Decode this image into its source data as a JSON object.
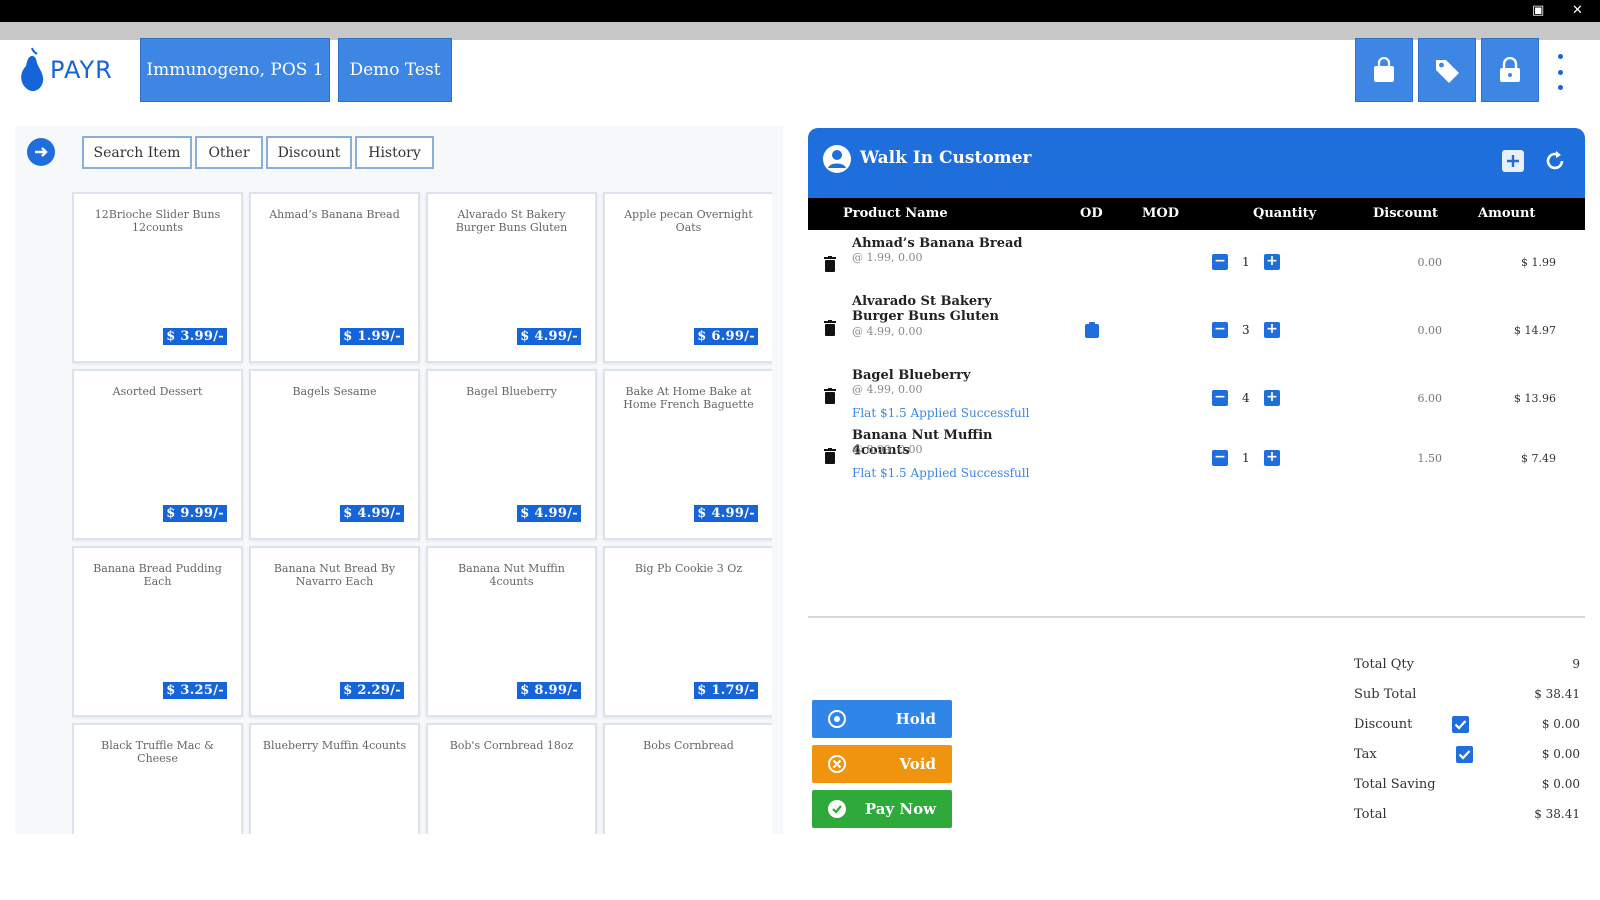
{
  "window": {
    "restore_glyph": "▣",
    "close_glyph": "✕"
  },
  "header": {
    "logo_text": "PAYR",
    "store_button": "Immunogeno, POS 1",
    "user_button": "Demo Test",
    "icons": [
      "bag-icon",
      "tag-icon",
      "lock-icon",
      "kebab-menu-icon"
    ]
  },
  "tabs": [
    "Search Item",
    "Other",
    "Discount",
    "History"
  ],
  "products": [
    {
      "name": "12Brioche Slider Buns 12counts",
      "price": "$ 3.99/-"
    },
    {
      "name": "Ahmad’s Banana Bread",
      "price": "$ 1.99/-"
    },
    {
      "name": "Alvarado St Bakery Burger Buns Gluten",
      "price": "$ 4.99/-"
    },
    {
      "name": "Apple pecan Overnight Oats",
      "price": "$ 6.99/-"
    },
    {
      "name": "Asorted Dessert",
      "price": "$ 9.99/-"
    },
    {
      "name": "Bagels Sesame",
      "price": "$ 4.99/-"
    },
    {
      "name": "Bagel Blueberry",
      "price": "$ 4.99/-"
    },
    {
      "name": "Bake At Home Bake at Home French Baguette",
      "price": "$ 4.99/-"
    },
    {
      "name": "Banana Bread Pudding Each",
      "price": "$ 3.25/-"
    },
    {
      "name": "Banana Nut Bread By Navarro Each",
      "price": "$ 2.29/-"
    },
    {
      "name": "Banana Nut Muffin 4counts",
      "price": "$ 8.99/-"
    },
    {
      "name": "Big Pb Cookie 3 Oz",
      "price": "$ 1.79/-"
    },
    {
      "name": "Black Truffle Mac & Cheese",
      "price": ""
    },
    {
      "name": "Blueberry Muffin 4counts",
      "price": ""
    },
    {
      "name": "Bob's Cornbread 18oz",
      "price": ""
    },
    {
      "name": "Bobs Cornbread",
      "price": ""
    }
  ],
  "customer": {
    "name": "Walk In Customer"
  },
  "table_headers": {
    "product": "Product Name",
    "od": "OD",
    "mod": "MOD",
    "quantity": "Quantity",
    "discount": "Discount",
    "amount": "Amount"
  },
  "cart": [
    {
      "name": "Ahmad’s Banana Bread",
      "sub": "@ 1.99,  0.00",
      "qty": "1",
      "discount": "0.00",
      "amount": "$ 1.99",
      "applied": ""
    },
    {
      "name": "Alvarado St Bakery Burger Buns Gluten",
      "sub": "@ 4.99,  0.00",
      "qty": "3",
      "discount": "0.00",
      "amount": "$ 14.97",
      "applied": ""
    },
    {
      "name": "Bagel Blueberry",
      "sub": "@ 4.99,  0.00",
      "qty": "4",
      "discount": "6.00",
      "amount": "$ 13.96",
      "applied": "Flat $1.5 Applied Successfull"
    },
    {
      "name": "Banana Nut Muffin 4counts",
      "sub": "@ 8.99,  0.00",
      "qty": "1",
      "discount": "1.50",
      "amount": "$ 7.49",
      "applied": "Flat $1.5 Applied Successfull"
    }
  ],
  "actions": {
    "hold": "Hold",
    "void": "Void",
    "pay": "Pay Now"
  },
  "summary": {
    "total_qty_label": "Total Qty",
    "total_qty": "9",
    "sub_total_label": "Sub Total",
    "sub_total": "$ 38.41",
    "discount_label": "Discount",
    "discount": "$ 0.00",
    "tax_label": "Tax",
    "tax": "$ 0.00",
    "total_saving_label": "Total Saving",
    "total_saving": "$ 0.00",
    "total_label": "Total",
    "total": "$ 38.41"
  },
  "colors": {
    "accent": "#1e6fdc",
    "hold": "#2f86e8",
    "void": "#f0930f",
    "pay": "#2eaa3a"
  }
}
